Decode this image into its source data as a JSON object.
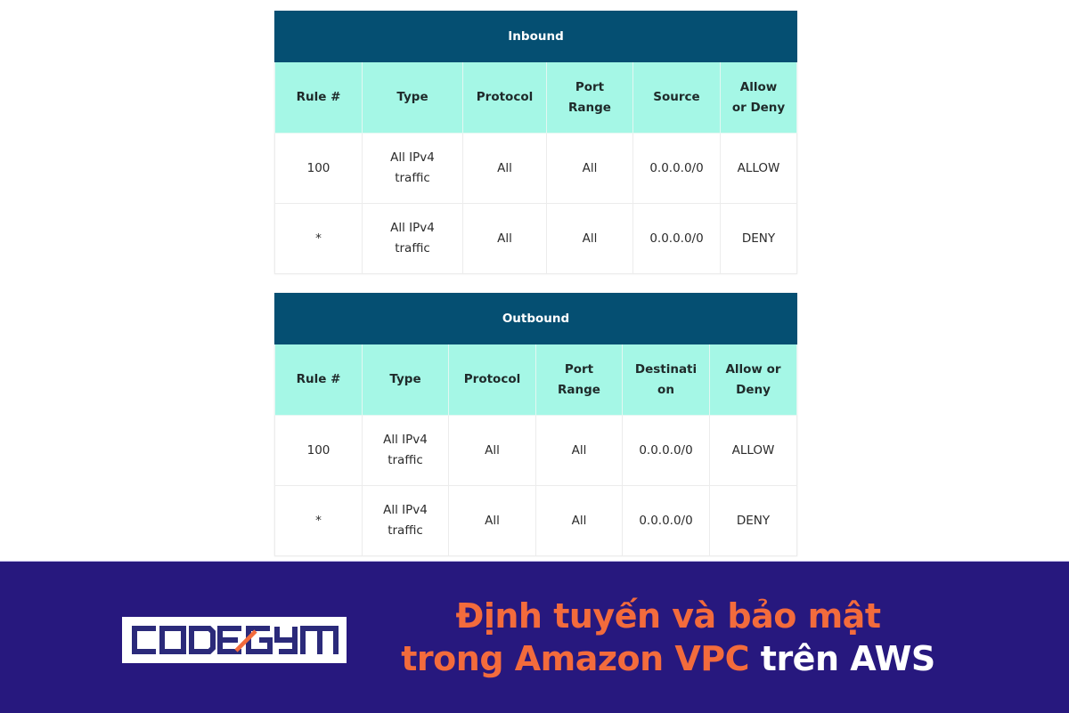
{
  "tables": {
    "inbound": {
      "title": "Inbound",
      "columns": [
        "Rule #",
        "Type",
        "Protocol",
        "Port\nRange",
        "Source",
        "Allow\nor Deny"
      ],
      "rows": [
        [
          "100",
          "All IPv4 traffic",
          "All",
          "All",
          "0.0.0.0/0",
          "ALLOW"
        ],
        [
          "*",
          "All IPv4 traffic",
          "All",
          "All",
          "0.0.0.0/0",
          "DENY"
        ]
      ]
    },
    "outbound": {
      "title": "Outbound",
      "columns": [
        "Rule #",
        "Type",
        "Protocol",
        "Port\nRange",
        "Destinati\non",
        "Allow or\nDeny"
      ],
      "rows": [
        [
          "100",
          "All IPv4 traffic",
          "All",
          "All",
          "0.0.0.0/0",
          "ALLOW"
        ],
        [
          "*",
          "All IPv4 traffic",
          "All",
          "All",
          "0.0.0.0/0",
          "DENY"
        ]
      ]
    }
  },
  "banner": {
    "logo_text": "CODEGYM",
    "headline_line1": "Định tuyến và bảo mật",
    "headline_line2_orange": "trong Amazon VPC",
    "headline_line2_white": "trên AWS"
  },
  "colors": {
    "table_title_bg": "#054f72",
    "table_header_bg": "#a5f7e6",
    "banner_bg": "#27187e",
    "accent_orange": "#f36b3c",
    "logo_blue": "#2b2a7a"
  }
}
